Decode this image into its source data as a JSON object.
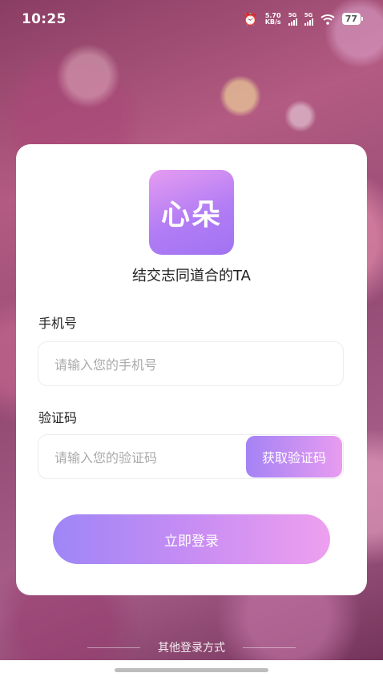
{
  "status_bar": {
    "time": "10:25",
    "net_speed_value": "5.70",
    "net_speed_unit": "KB/s",
    "sim1": "5G",
    "sim2": "5G",
    "battery": "77",
    "icons": [
      "alarm-icon",
      "signal-icon",
      "wifi-icon",
      "battery-icon"
    ]
  },
  "app": {
    "logo_text": "心朵",
    "tagline": "结交志同道合的TA"
  },
  "form": {
    "phone_label": "手机号",
    "phone_placeholder": "请输入您的手机号",
    "phone_value": "",
    "code_label": "验证码",
    "code_placeholder": "请输入您的验证码",
    "code_value": "",
    "get_code_label": "获取验证码",
    "login_label": "立即登录"
  },
  "other_login": {
    "label": "其他登录方式"
  },
  "colors": {
    "accent_start": "#9e86f6",
    "accent_end": "#eea0ef",
    "card_bg": "#ffffff"
  }
}
